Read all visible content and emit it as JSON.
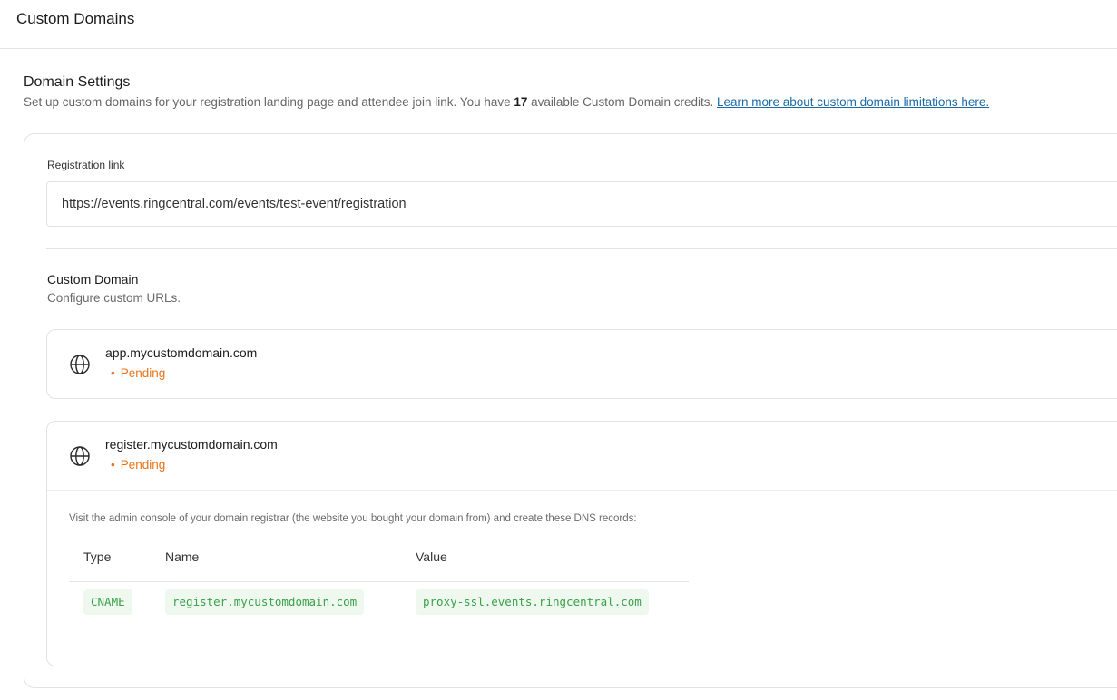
{
  "header": {
    "title": "Custom Domains"
  },
  "settings": {
    "title": "Domain Settings",
    "desc_before": "Set up custom domains for your registration landing page and attendee join link. You have ",
    "credits": "17",
    "desc_after": " available Custom Domain credits. ",
    "link": "Learn more about custom domain limitations here."
  },
  "registration": {
    "label": "Registration link",
    "value": "https://events.ringcentral.com/events/test-event/registration"
  },
  "custom_domain": {
    "title": "Custom Domain",
    "subtitle": "Configure custom URLs."
  },
  "domains": [
    {
      "name": "app.mycustomdomain.com",
      "status": "Pending",
      "icon": "globe-icon"
    },
    {
      "name": "register.mycustomdomain.com",
      "status": "Pending",
      "icon": "globe-icon"
    }
  ],
  "status_dot": "•",
  "dns": {
    "instructions": "Visit the admin console of your domain registrar (the website you bought your domain from) and create these DNS records:",
    "headers": [
      "Type",
      "Name",
      "Value"
    ],
    "rows": [
      [
        "CNAME",
        "register.mycustomdomain.com",
        "proxy-ssl.events.ringcentral.com"
      ]
    ]
  },
  "colors": {
    "pending": "#e8741c",
    "code_text": "#3aa14a",
    "code_bg": "#eef8ef",
    "link": "#1a6aa8"
  }
}
